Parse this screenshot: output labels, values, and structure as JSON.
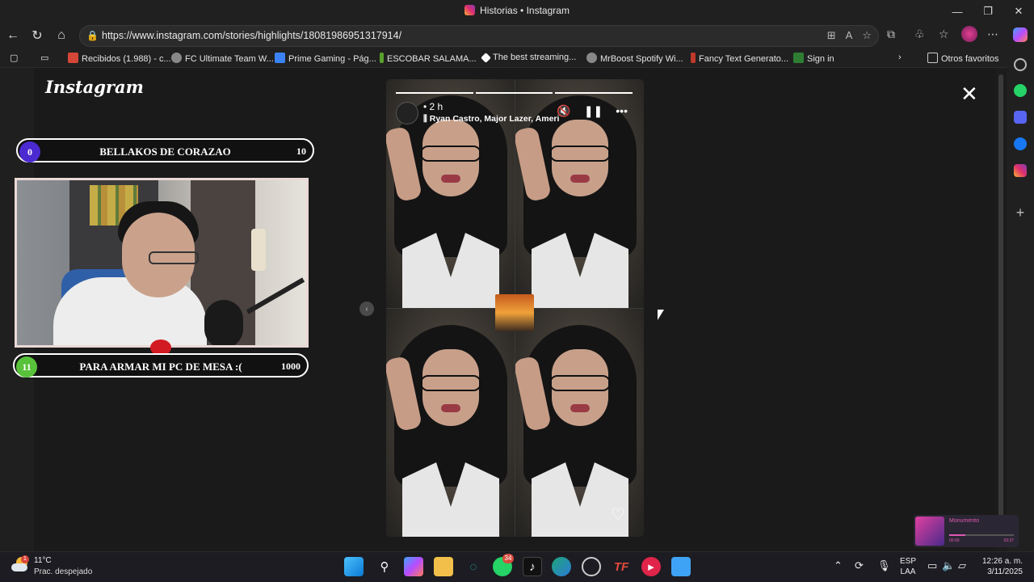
{
  "window": {
    "title": "Historias • Instagram"
  },
  "address": {
    "url": "https://www.instagram.com/stories/highlights/18081986951317914/"
  },
  "bookmarks": [
    {
      "label": "Recibidos (1.988) - c...",
      "color": "#d44638"
    },
    {
      "label": "FC Ultimate Team W...",
      "color": "#cfcfcf"
    },
    {
      "label": "Prime Gaming - Pág...",
      "color": "#3b82f6"
    },
    {
      "label": "ESCOBAR SALAMA...",
      "color": "#5aa02c"
    },
    {
      "label": "The best streaming...",
      "color": "#ffffff"
    },
    {
      "label": "MrBoost Spotify Wi...",
      "color": "#cfcfcf"
    },
    {
      "label": "Fancy Text Generato...",
      "color": "#c0392b"
    },
    {
      "label": "Sign in",
      "color": "#2e7d32"
    }
  ],
  "bookmarks_other": "Otros favoritos",
  "instagram": {
    "logo": "Instagram"
  },
  "story": {
    "time": "2 h",
    "music": "Ryan Castro, Major Lazer, America",
    "progress_done": 3,
    "progress_total": 3
  },
  "overlay": {
    "top_pill": {
      "count": "0",
      "text": "BELLAKOS DE CORAZAO",
      "goal": "10"
    },
    "bottom_pill": {
      "count": "11",
      "text": "PARA ARMAR MI PC DE MESA :(",
      "goal": "1000"
    }
  },
  "miniplayer": {
    "title": "Monumento",
    "time_left": "00:00",
    "time_right": "03:37"
  },
  "taskbar": {
    "weather_temp": "11°C",
    "weather_desc": "Prac. despejado",
    "weather_badge": "1",
    "whatsapp_badge": "34",
    "lang1": "ESP",
    "lang2": "LAA",
    "time": "12:26 a. m.",
    "date": "3/11/2025"
  }
}
